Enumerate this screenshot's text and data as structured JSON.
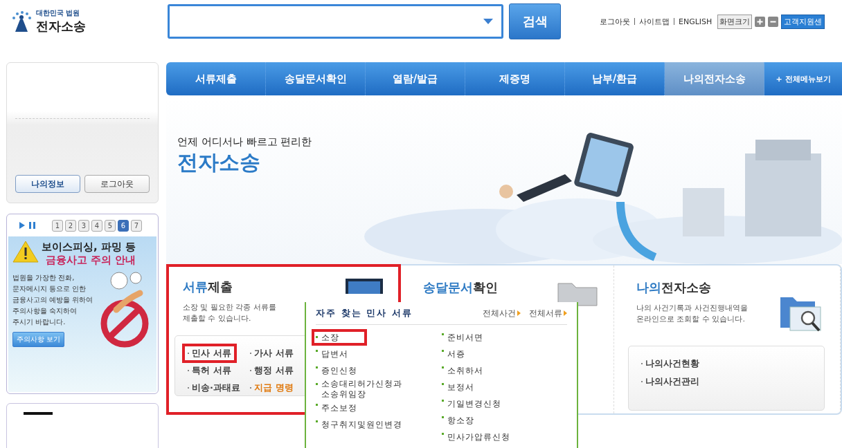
{
  "logo": {
    "subtitle": "대한민국 법원",
    "title": "전자소송"
  },
  "search_button": "검색",
  "top_links": [
    "로그아웃",
    "사이트맵",
    "ENGLISH"
  ],
  "font_size": {
    "label": "화면크기"
  },
  "support_button": "고객지원센",
  "nav": {
    "tabs": [
      {
        "label": "서류제출",
        "selected": false
      },
      {
        "label": "송달문서확인",
        "selected": false
      },
      {
        "label": "열람/발급",
        "selected": false
      },
      {
        "label": "제증명",
        "selected": false
      },
      {
        "label": "납부/환급",
        "selected": false
      },
      {
        "label": "나의전자소송",
        "selected": true
      }
    ],
    "all_menu": "+ 전체메뉴보기"
  },
  "login_panel": {
    "buttons": [
      "나의정보",
      "로그아웃"
    ]
  },
  "banner": {
    "pages": [
      {
        "label": "1",
        "selected": false
      },
      {
        "label": "2",
        "selected": false
      },
      {
        "label": "3",
        "selected": false
      },
      {
        "label": "4",
        "selected": false
      },
      {
        "label": "5",
        "selected": false
      },
      {
        "label": "6",
        "selected": true
      },
      {
        "label": "7",
        "selected": false
      }
    ],
    "headline": "보이스피싱, 파밍 등",
    "headline_2": "금융사고 주의 안내",
    "body_lines": [
      "법원을 가장한 전화,",
      "문자메시지 등으로 인한",
      "금융사고의 예방을 위하여",
      "주의사항을 숙지하여",
      "주시기 바랍니다."
    ],
    "button": "주의사항 보기"
  },
  "hero": {
    "tagline": "언제 어디서나 빠르고 편리한",
    "title": "전자소송"
  },
  "services": [
    {
      "kind": "submit",
      "title_accent": "서류",
      "title_rest": "제출",
      "description": [
        "소장 및 필요한 각종 서류를",
        "제출할 수 있습니다."
      ],
      "highlighted": true,
      "links": [
        {
          "label": "민사 서류",
          "kind": "normal",
          "highlighted": true
        },
        {
          "label": "가사 서류",
          "kind": "normal",
          "highlighted": false
        },
        {
          "label": "특허 서류",
          "kind": "normal",
          "highlighted": false
        },
        {
          "label": "행정 서류",
          "kind": "normal",
          "highlighted": false
        },
        {
          "label": "비송·과태료",
          "kind": "normal",
          "highlighted": false
        },
        {
          "label": "지급 명령",
          "kind": "featured",
          "highlighted": false
        }
      ]
    },
    {
      "kind": "delivery",
      "title_accent": "송달문서",
      "title_rest": "확인",
      "highlighted": false
    },
    {
      "kind": "mycase",
      "title_accent": "나의",
      "title_rest": "전자소송",
      "description": [
        "나의 사건기록과 사건진행내역을",
        "온라인으로 조회할 수 있습니다."
      ],
      "highlighted": false,
      "links": [
        {
          "label": "나의사건현황",
          "kind": "normal",
          "highlighted": false
        },
        {
          "label": "나의사건관리",
          "kind": "normal",
          "highlighted": false
        }
      ]
    }
  ],
  "popup": {
    "title": "자주 찾는 민사 서류",
    "links": [
      "전체사건",
      "전체서류"
    ],
    "columns": [
      [
        {
          "label": "소장",
          "highlighted": true
        },
        {
          "label": "답변서",
          "highlighted": false
        },
        {
          "label": "증인신청",
          "highlighted": false
        },
        {
          "label": "소송대리허가신청과 소송위임장",
          "highlighted": false
        },
        {
          "label": "주소보정",
          "highlighted": false
        },
        {
          "label": "청구취지및원인변경",
          "highlighted": false
        }
      ],
      [
        {
          "label": "준비서면",
          "highlighted": false
        },
        {
          "label": "서증",
          "highlighted": false
        },
        {
          "label": "소취하서",
          "highlighted": false
        },
        {
          "label": "보정서",
          "highlighted": false
        },
        {
          "label": "기일변경신청",
          "highlighted": false
        },
        {
          "label": "항소장",
          "highlighted": false
        },
        {
          "label": "민사가압류신청",
          "highlighted": false
        }
      ]
    ]
  }
}
